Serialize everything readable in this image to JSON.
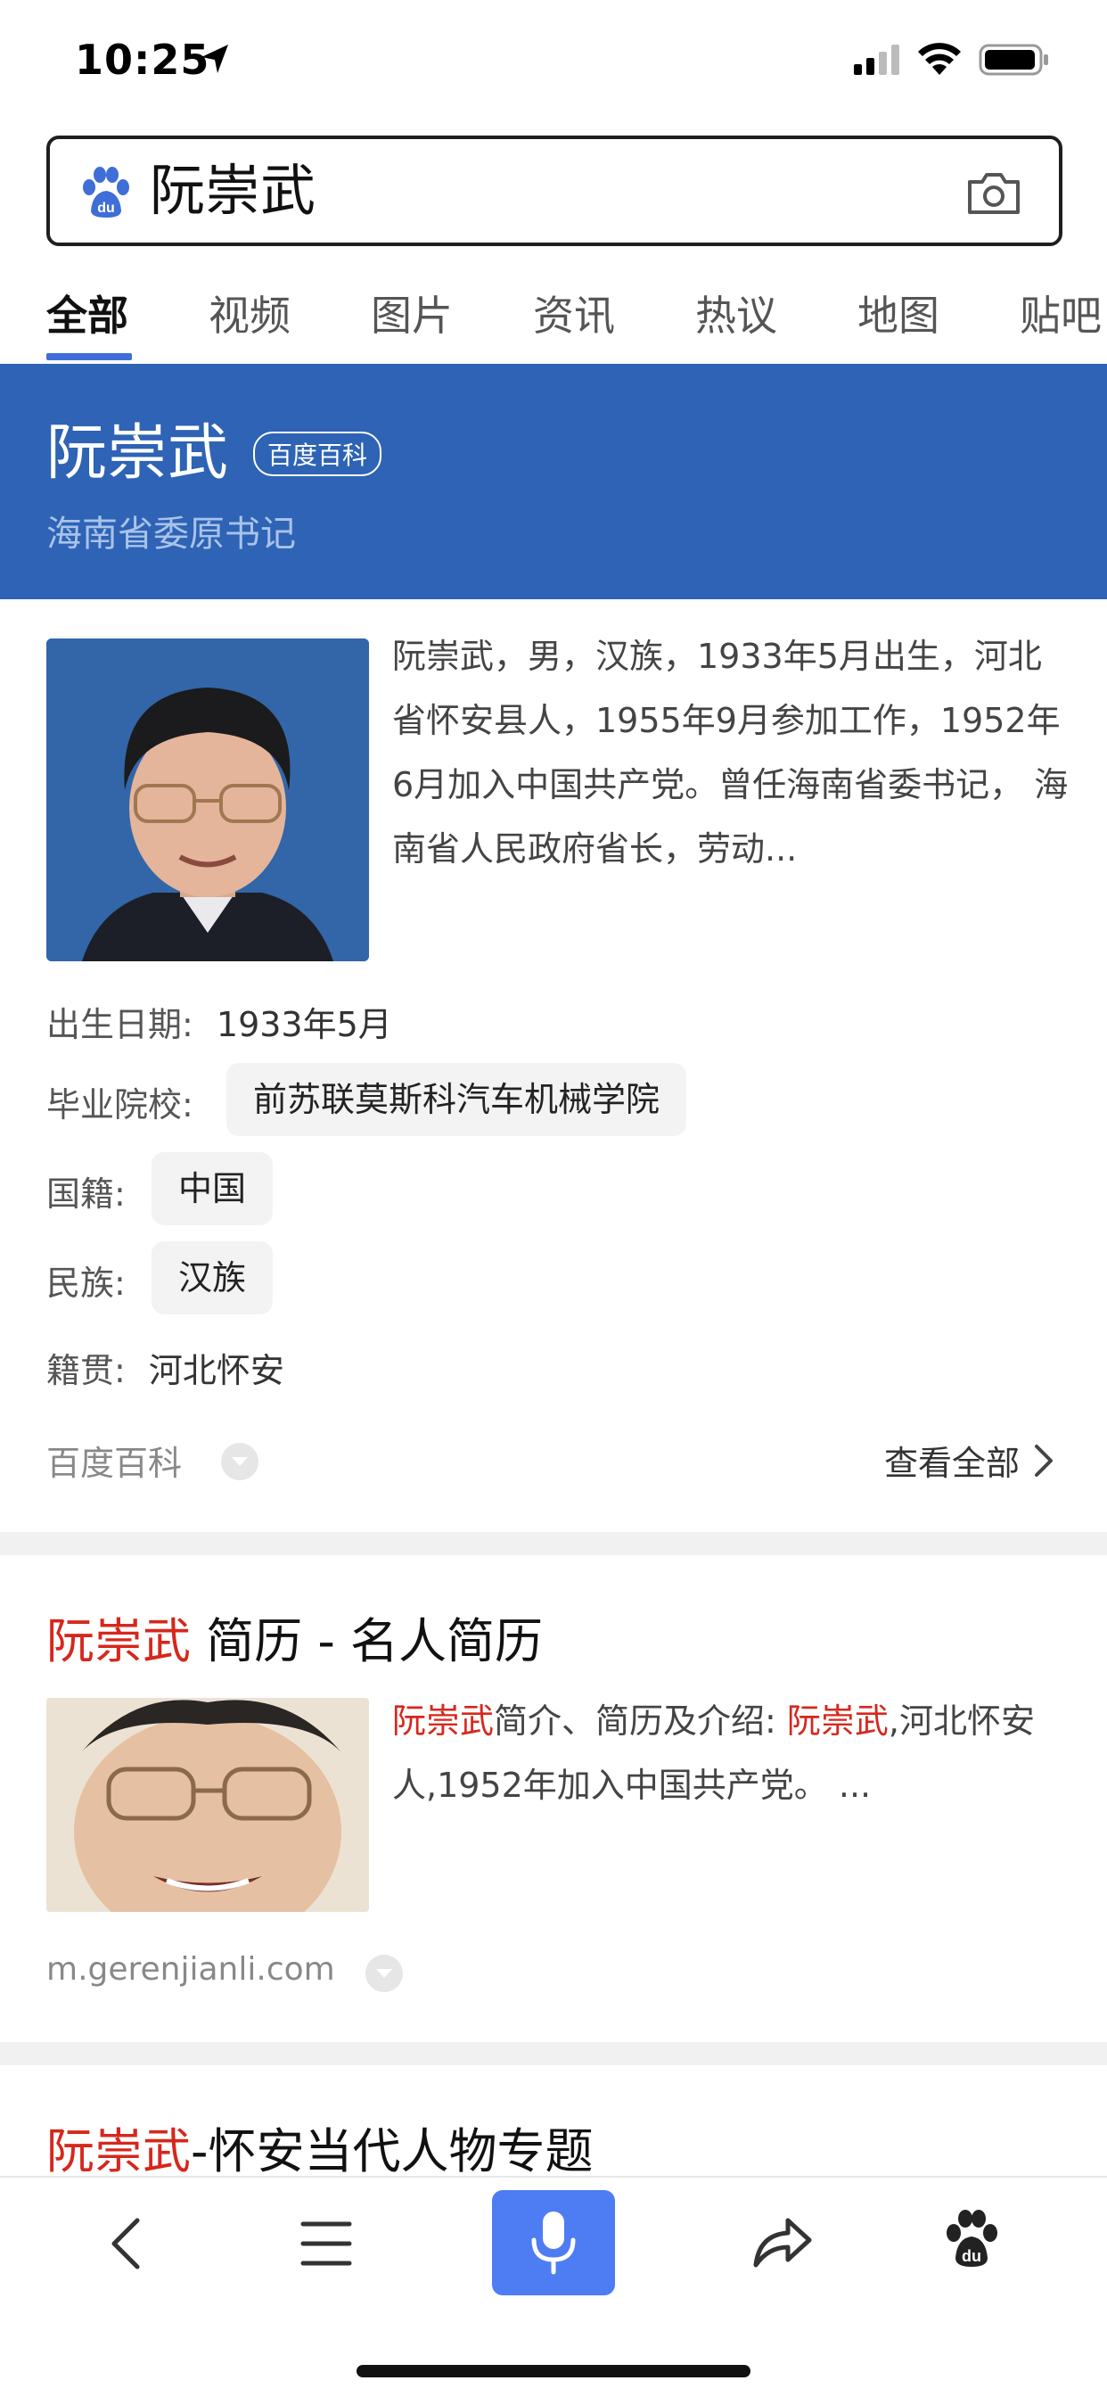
{
  "status": {
    "time": "10:25"
  },
  "search": {
    "query": "阮崇武"
  },
  "tabs": [
    {
      "label": "全部",
      "active": true
    },
    {
      "label": "视频"
    },
    {
      "label": "图片"
    },
    {
      "label": "资讯"
    },
    {
      "label": "热议"
    },
    {
      "label": "地图"
    },
    {
      "label": "贴吧"
    }
  ],
  "hero": {
    "title": "阮崇武",
    "badge": "百度百科",
    "subtitle": "海南省委原书记"
  },
  "baike": {
    "summary": "阮崇武，男，汉族，1933年5月出生，河北省怀安县人，1955年9月参加工作，1952年6月加入中国共产党。曾任海南省委书记， 海南省人民政府省长，劳动...",
    "birth_label": "出生日期:",
    "birth_value": "1933年5月",
    "school_label": "毕业院校:",
    "school_value": "前苏联莫斯科汽车机械学院",
    "nationality_label": "国籍:",
    "nationality_value": "中国",
    "ethnic_label": "民族:",
    "ethnic_value": "汉族",
    "origin_label": "籍贯:",
    "origin_value": "河北怀安",
    "source": "百度百科",
    "view_all": "查看全部"
  },
  "result1": {
    "title_hl": "阮崇武",
    "title_rest": " 简历 - 名人简历",
    "snippet_hl1": "阮崇武",
    "snippet_1": "简介、简历及介绍: ",
    "snippet_hl2": "阮崇武",
    "snippet_2": ",河北怀安人,1952年加入中国共产党。 ...",
    "url": "m.gerenjianli.com"
  },
  "result2": {
    "title_hl": "阮崇武",
    "title_rest": "-怀安当代人物专题"
  },
  "colors": {
    "accent": "#3f6ed8",
    "hero_bg": "#2e63b5",
    "highlight": "#d6271c",
    "mic": "#4e7cf3"
  }
}
